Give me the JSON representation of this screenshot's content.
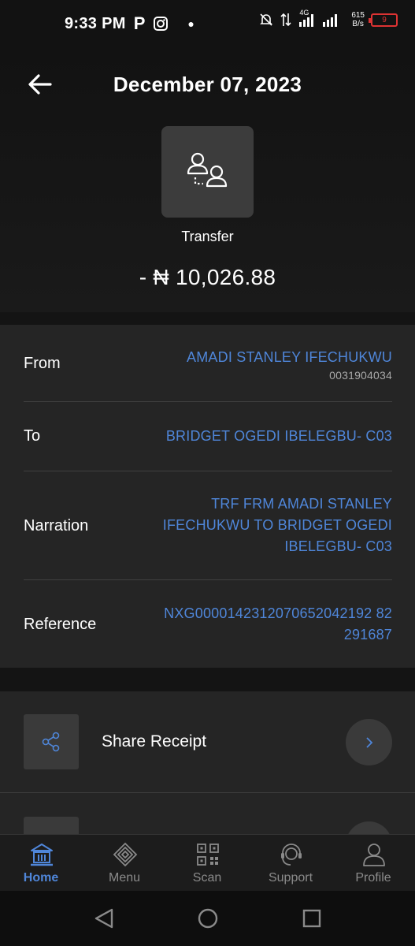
{
  "status_bar": {
    "time": "9:33 PM",
    "net_speed_value": "615",
    "net_speed_unit": "B/s",
    "network": "4G",
    "battery_level": "9"
  },
  "header": {
    "title": "December 07, 2023",
    "transaction_type": "Transfer",
    "amount": "- ₦ 10,026.88"
  },
  "details": {
    "from": {
      "label": "From",
      "name": "AMADI STANLEY IFECHUKWU",
      "account": "0031904034"
    },
    "to": {
      "label": "To",
      "value": "BRIDGET OGEDI IBELEGBU- C03"
    },
    "narration": {
      "label": "Narration",
      "line1": "TRF FRM AMADI STANLEY",
      "line2": "IFECHUKWU TO BRIDGET OGEDI",
      "line3": "IBELEGBU- C03"
    },
    "reference": {
      "label": "Reference",
      "line1": "NXG0000142312070652042192 82",
      "line2": "291687"
    }
  },
  "actions": {
    "share_label": "Share Receipt"
  },
  "bottom_nav": {
    "items": [
      {
        "label": "Home"
      },
      {
        "label": "Menu"
      },
      {
        "label": "Scan"
      },
      {
        "label": "Support"
      },
      {
        "label": "Profile"
      }
    ]
  },
  "colors": {
    "accent": "#4f86d9",
    "background": "#141414",
    "card": "#252525"
  }
}
